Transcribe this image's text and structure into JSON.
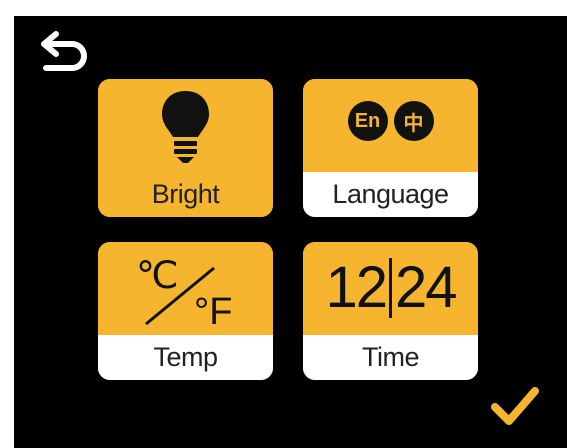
{
  "header": {
    "back_icon": "back-arrow-icon"
  },
  "tiles": [
    {
      "id": "bright",
      "label": "Bright",
      "icon": "lightbulb-icon"
    },
    {
      "id": "language",
      "label": "Language",
      "icon": "language-icon",
      "badges": [
        "En",
        "中"
      ]
    },
    {
      "id": "temp",
      "label": "Temp",
      "icon": "celsius-fahrenheit-icon",
      "units": [
        "℃",
        "°F"
      ]
    },
    {
      "id": "time",
      "label": "Time",
      "icon": "time-format-icon",
      "formats": [
        "12",
        "24"
      ]
    }
  ],
  "footer": {
    "confirm_icon": "checkmark-icon"
  },
  "colors": {
    "accent": "#f5b52e",
    "background": "#000000",
    "label_white": "#ffffff",
    "icon_dark": "#111111"
  }
}
